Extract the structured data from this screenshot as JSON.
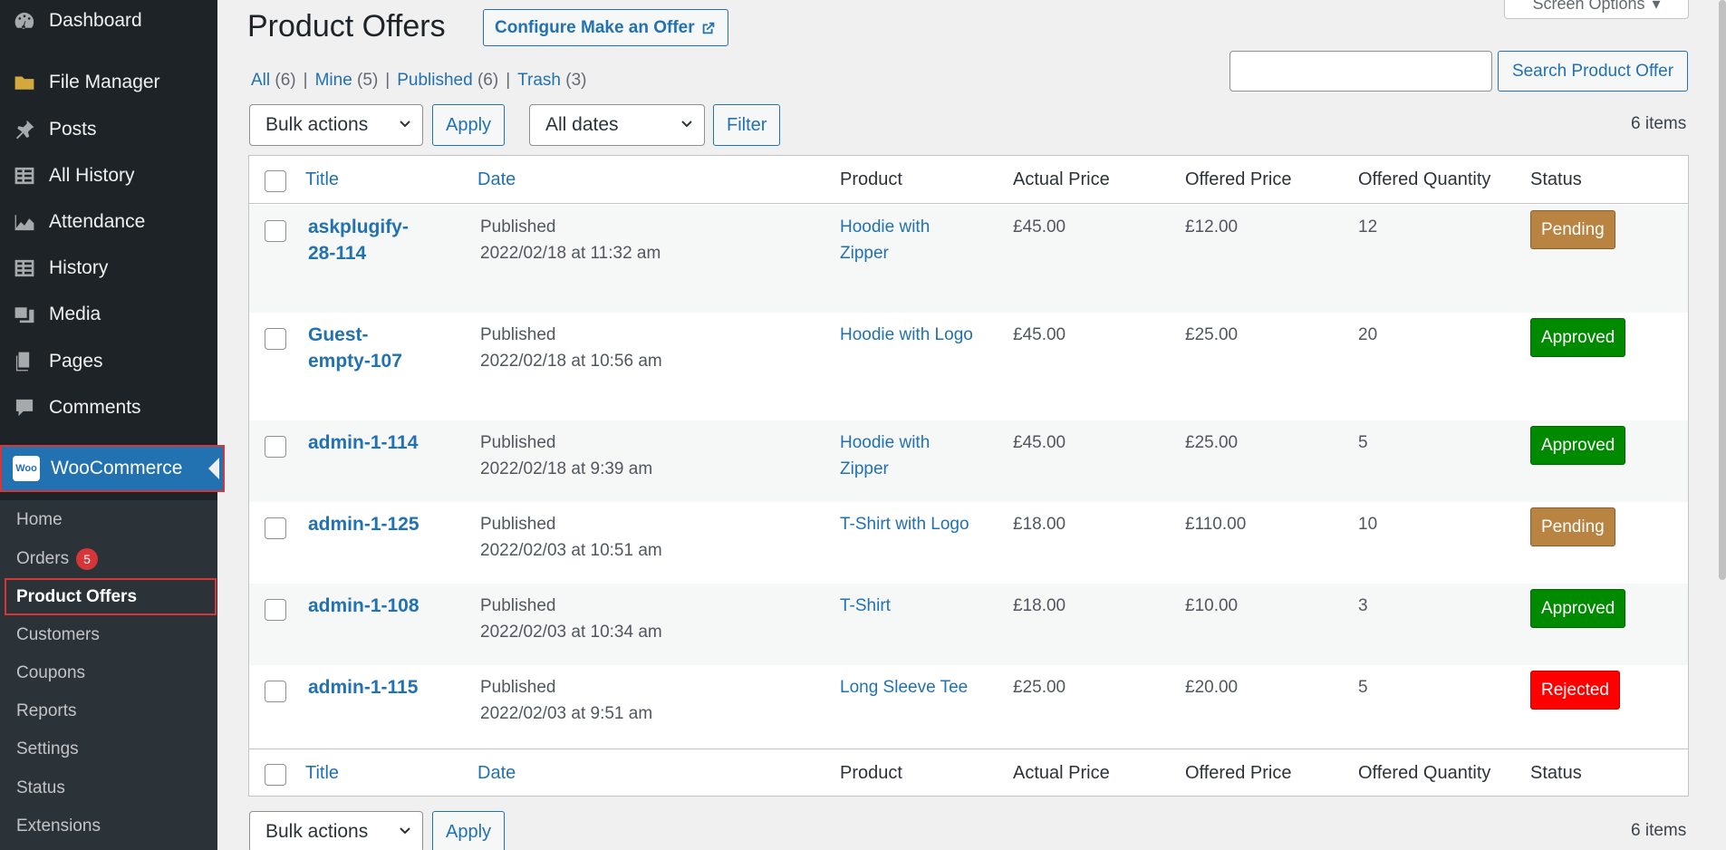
{
  "sidebar": {
    "items": [
      {
        "label": "Dashboard",
        "icon": "dashboard-icon"
      },
      {
        "label": "File Manager",
        "icon": "folder-icon"
      },
      {
        "label": "Posts",
        "icon": "pin-icon"
      },
      {
        "label": "All History",
        "icon": "table-icon"
      },
      {
        "label": "Attendance",
        "icon": "chart-area-icon"
      },
      {
        "label": "History",
        "icon": "table-icon"
      },
      {
        "label": "Media",
        "icon": "media-icon"
      },
      {
        "label": "Pages",
        "icon": "pages-icon"
      },
      {
        "label": "Comments",
        "icon": "comment-icon"
      },
      {
        "label": "WooCommerce",
        "icon": "woocommerce-icon"
      }
    ],
    "woo_logo_text": "Woo",
    "submenu": {
      "home": "Home",
      "orders": "Orders",
      "orders_count": "5",
      "product_offers": "Product Offers",
      "customers": "Customers",
      "coupons": "Coupons",
      "reports": "Reports",
      "settings": "Settings",
      "status": "Status",
      "extensions": "Extensions"
    }
  },
  "header": {
    "title": "Product Offers",
    "configure_button": "Configure Make an Offer",
    "screen_options": "Screen Options"
  },
  "filters": {
    "all": "All",
    "all_count": "(6)",
    "mine": "Mine",
    "mine_count": "(5)",
    "published": "Published",
    "published_count": "(6)",
    "trash": "Trash",
    "trash_count": "(3)",
    "separator": "|"
  },
  "search": {
    "value": "",
    "button": "Search Product Offer"
  },
  "toolbar": {
    "bulk_actions": "Bulk actions",
    "apply": "Apply",
    "all_dates": "All dates",
    "filter": "Filter",
    "items_count": "6 items"
  },
  "table": {
    "columns": {
      "title": "Title",
      "date": "Date",
      "product": "Product",
      "actual_price": "Actual Price",
      "offered_price": "Offered Price",
      "offered_quantity": "Offered Quantity",
      "status": "Status"
    },
    "rows": [
      {
        "title_l1": "askplugify-",
        "title_l2": "28-114",
        "date_status": "Published",
        "date": "2022/02/18 at 11:32 am",
        "product_l1": "Hoodie with",
        "product_l2": "Zipper",
        "actual_price": "£45.00",
        "offered_price": "£12.00",
        "quantity": "12",
        "status": "Pending"
      },
      {
        "title_l1": "Guest-",
        "title_l2": "empty-107",
        "date_status": "Published",
        "date": "2022/02/18 at 10:56 am",
        "product_l1": "Hoodie with Logo",
        "product_l2": "",
        "actual_price": "£45.00",
        "offered_price": "£25.00",
        "quantity": "20",
        "status": "Approved"
      },
      {
        "title_l1": "admin-1-114",
        "title_l2": "",
        "date_status": "Published",
        "date": "2022/02/18 at 9:39 am",
        "product_l1": "Hoodie with",
        "product_l2": "Zipper",
        "actual_price": "£45.00",
        "offered_price": "£25.00",
        "quantity": "5",
        "status": "Approved"
      },
      {
        "title_l1": "admin-1-125",
        "title_l2": "",
        "date_status": "Published",
        "date": "2022/02/03 at 10:51 am",
        "product_l1": "T-Shirt with Logo",
        "product_l2": "",
        "actual_price": "£18.00",
        "offered_price": "£110.00",
        "quantity": "10",
        "status": "Pending"
      },
      {
        "title_l1": "admin-1-108",
        "title_l2": "",
        "date_status": "Published",
        "date": "2022/02/03 at 10:34 am",
        "product_l1": "T-Shirt",
        "product_l2": "",
        "actual_price": "£18.00",
        "offered_price": "£10.00",
        "quantity": "3",
        "status": "Approved"
      },
      {
        "title_l1": "admin-1-115",
        "title_l2": "",
        "date_status": "Published",
        "date": "2022/02/03 at 9:51 am",
        "product_l1": "Long Sleeve Tee",
        "product_l2": "",
        "actual_price": "£25.00",
        "offered_price": "£20.00",
        "quantity": "5",
        "status": "Rejected"
      }
    ]
  },
  "colors": {
    "accent": "#2271b1",
    "sidebar_bg": "#1d2327",
    "pending": "#b98342",
    "approved": "#008a00",
    "rejected": "#ff0000",
    "highlight_border": "#d63638"
  }
}
